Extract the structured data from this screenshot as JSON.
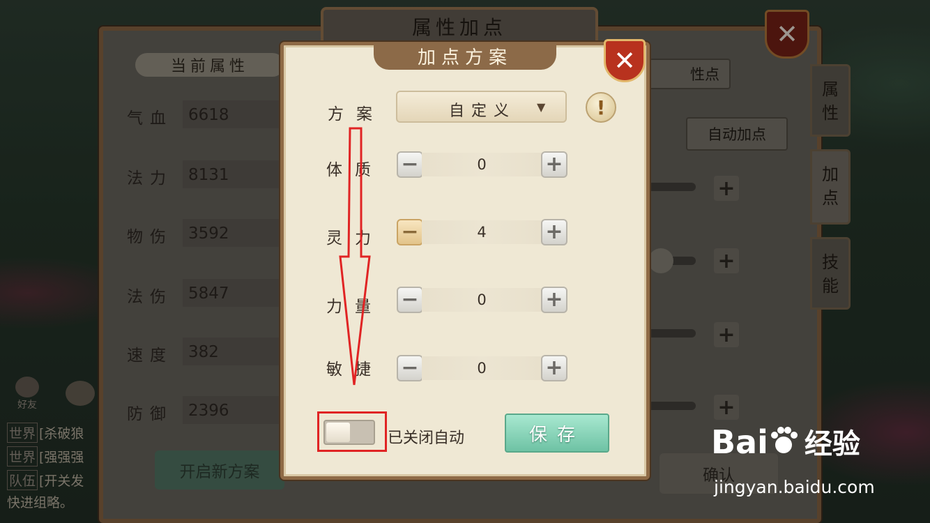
{
  "main": {
    "title": "属性加点",
    "close_label": "✕",
    "section_title": "当前属性",
    "attributes": [
      {
        "label": "气血",
        "value": "6618"
      },
      {
        "label": "法力",
        "value": "8131"
      },
      {
        "label": "物伤",
        "value": "3592"
      },
      {
        "label": "法伤",
        "value": "5847"
      },
      {
        "label": "速度",
        "value": "382"
      },
      {
        "label": "防御",
        "value": "2396"
      }
    ],
    "reset_points_button": "性点",
    "auto_add_button": "自动加点",
    "new_plan_button": "开启新方案",
    "confirm_button": "确认"
  },
  "side_tabs": [
    "属\n性",
    "加\n点",
    "技\n能"
  ],
  "chat": {
    "friend_label": "好友",
    "lines": [
      {
        "tag": "世界",
        "text": "[杀破狼"
      },
      {
        "tag": "世界",
        "text": "[强强强"
      },
      {
        "tag": "队伍",
        "text": "[开关发"
      },
      {
        "tag": "",
        "text": "快进组略。"
      }
    ]
  },
  "dialog": {
    "title": "加点方案",
    "close_label": "✕",
    "plan_label": "方案",
    "plan_value": "自定义",
    "plan_arrow": "▼",
    "info_symbol": "!",
    "minus_symbol": "−",
    "plus_symbol": "+",
    "stats": [
      {
        "label": "体质",
        "value": "0"
      },
      {
        "label": "灵力",
        "value": "4"
      },
      {
        "label": "力量",
        "value": "0"
      },
      {
        "label": "敏捷",
        "value": "0"
      }
    ],
    "toggle_state": "off",
    "toggle_text": "已关闭自动",
    "save_button": "保存"
  },
  "watermark": {
    "brand": "Bai",
    "brand_suffix": "经验",
    "url": "jingyan.baidu.com"
  },
  "colors": {
    "annotation": "#e02424",
    "save": "#6ec2a4",
    "dialog_bg": "#efe8d4"
  },
  "icons": [
    "close-icon",
    "info-icon",
    "minus-icon",
    "plus-icon",
    "dropdown-arrow-icon",
    "baidu-paw-icon"
  ]
}
